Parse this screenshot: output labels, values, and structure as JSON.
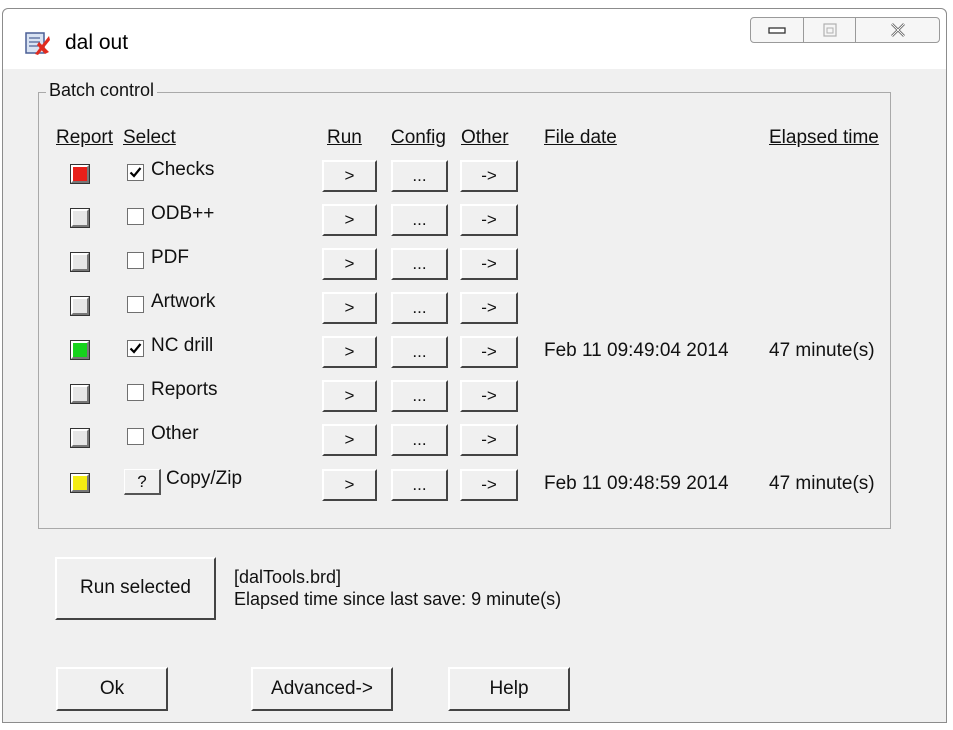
{
  "window": {
    "title": "dal out"
  },
  "batch": {
    "group_label": "Batch control",
    "headers": {
      "report": "Report",
      "select": "Select",
      "run": "Run",
      "config": "Config",
      "other": "Other",
      "file_date": "File date",
      "elapsed_time": "Elapsed time"
    },
    "buttons": {
      "run": ">",
      "config": "...",
      "other": "->",
      "question": "?"
    },
    "rows": [
      {
        "label": "Checks",
        "checked": true,
        "status_color": "#e8201a",
        "file_date": "",
        "elapsed": ""
      },
      {
        "label": "ODB++",
        "checked": false,
        "status_color": "#e6e6e6",
        "file_date": "",
        "elapsed": ""
      },
      {
        "label": "PDF",
        "checked": false,
        "status_color": "#e6e6e6",
        "file_date": "",
        "elapsed": ""
      },
      {
        "label": "Artwork",
        "checked": false,
        "status_color": "#e6e6e6",
        "file_date": "",
        "elapsed": ""
      },
      {
        "label": "NC drill",
        "checked": true,
        "status_color": "#16d21c",
        "file_date": "Feb 11 09:49:04 2014",
        "elapsed": "47 minute(s)"
      },
      {
        "label": "Reports",
        "checked": false,
        "status_color": "#e6e6e6",
        "file_date": "",
        "elapsed": ""
      },
      {
        "label": "Other",
        "checked": false,
        "status_color": "#e6e6e6",
        "file_date": "",
        "elapsed": ""
      },
      {
        "label": "Copy/Zip",
        "checked": false,
        "status_color": "#f4ec12",
        "file_date": "Feb 11 09:48:59 2014",
        "elapsed": "47 minute(s)",
        "question_button": true
      }
    ]
  },
  "run_selected": {
    "label": "Run selected"
  },
  "info": {
    "file": "[dalTools.brd]",
    "elapsed_since_save": "Elapsed time since last save: 9 minute(s)"
  },
  "footer": {
    "ok": "Ok",
    "advanced": "Advanced->",
    "help": "Help"
  }
}
